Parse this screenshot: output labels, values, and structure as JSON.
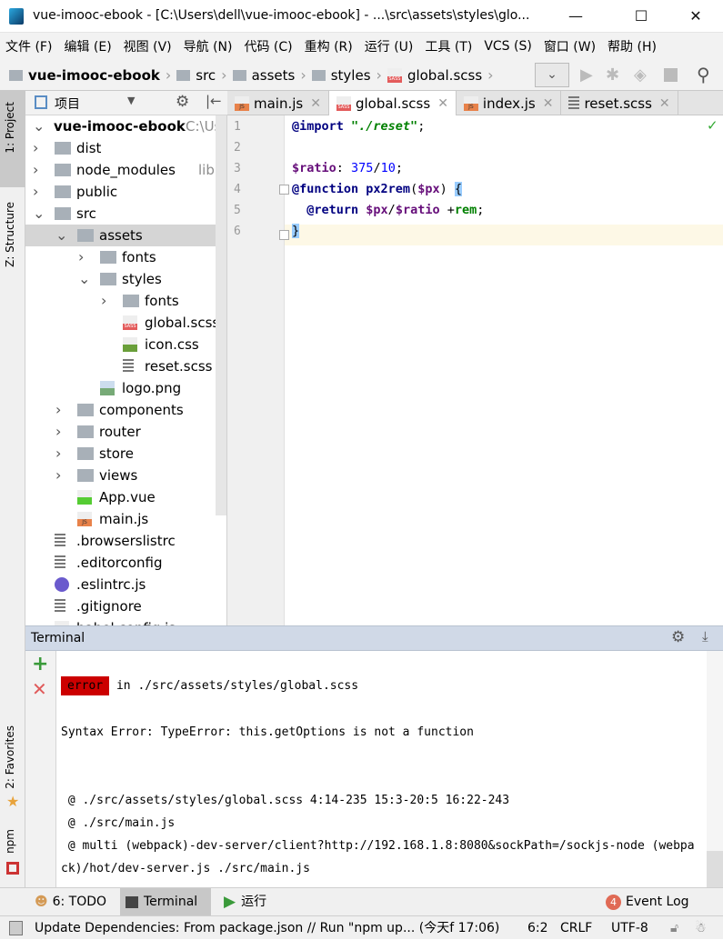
{
  "window": {
    "title": "vue-imooc-ebook - [C:\\Users\\dell\\vue-imooc-ebook] - ...\\src\\assets\\styles\\glo...",
    "minimize": "—",
    "maximize": "☐",
    "close": "✕"
  },
  "menu": [
    "文件 (F)",
    "编辑 (E)",
    "视图 (V)",
    "导航 (N)",
    "代码 (C)",
    "重构 (R)",
    "运行 (U)",
    "工具 (T)",
    "VCS (S)",
    "窗口 (W)",
    "帮助 (H)"
  ],
  "breadcrumb": [
    "vue-imooc-ebook",
    "src",
    "assets",
    "styles",
    "global.scss"
  ],
  "toolstrip": {
    "project": "1: Project",
    "structure": "Z: Structure",
    "favorites": "2: Favorites",
    "npm": "npm"
  },
  "project_panel": {
    "title": "项目"
  },
  "tree": [
    {
      "label": "vue-imooc-ebook",
      "hint": "C:\\Users",
      "depth": 0,
      "type": "root",
      "expanded": true
    },
    {
      "label": "dist",
      "depth": 0,
      "type": "folder",
      "expanded": false
    },
    {
      "label": "node_modules",
      "hint": "library",
      "depth": 0,
      "type": "folder",
      "expanded": false
    },
    {
      "label": "public",
      "depth": 0,
      "type": "folder",
      "expanded": false
    },
    {
      "label": "src",
      "depth": 0,
      "type": "folder",
      "expanded": true
    },
    {
      "label": "assets",
      "depth": 1,
      "type": "folder",
      "expanded": true,
      "selected": true
    },
    {
      "label": "fonts",
      "depth": 2,
      "type": "folder",
      "expanded": false
    },
    {
      "label": "styles",
      "depth": 2,
      "type": "folder",
      "expanded": true
    },
    {
      "label": "fonts",
      "depth": 3,
      "type": "folder",
      "expanded": false
    },
    {
      "label": "global.scss",
      "depth": 3,
      "type": "sass"
    },
    {
      "label": "icon.css",
      "depth": 3,
      "type": "css"
    },
    {
      "label": "reset.scss",
      "depth": 3,
      "type": "text"
    },
    {
      "label": "logo.png",
      "depth": 2,
      "type": "image"
    },
    {
      "label": "components",
      "depth": 1,
      "type": "folder",
      "expanded": false
    },
    {
      "label": "router",
      "depth": 1,
      "type": "folder",
      "expanded": false
    },
    {
      "label": "store",
      "depth": 1,
      "type": "folder",
      "expanded": false
    },
    {
      "label": "views",
      "depth": 1,
      "type": "folder",
      "expanded": false
    },
    {
      "label": "App.vue",
      "depth": 1,
      "type": "vue"
    },
    {
      "label": "main.js",
      "depth": 1,
      "type": "js"
    },
    {
      "label": ".browserslistrc",
      "depth": 0,
      "type": "text"
    },
    {
      "label": ".editorconfig",
      "depth": 0,
      "type": "text"
    },
    {
      "label": ".eslintrc.js",
      "depth": 0,
      "type": "eslint"
    },
    {
      "label": ".gitignore",
      "depth": 0,
      "type": "text"
    },
    {
      "label": "babel.config.js",
      "depth": 0,
      "type": "js"
    }
  ],
  "tabs": [
    {
      "label": "main.js",
      "icon": "js",
      "active": false
    },
    {
      "label": "global.scss",
      "icon": "sass",
      "active": true
    },
    {
      "label": "index.js",
      "icon": "js",
      "active": false
    },
    {
      "label": "reset.scss",
      "icon": "text",
      "active": false
    }
  ],
  "editor": {
    "line_numbers": [
      "1",
      "2",
      "3",
      "4",
      "5",
      "6"
    ],
    "lines": [
      [
        {
          "t": "@import ",
          "c": "kw"
        },
        {
          "t": "\"./reset\"",
          "c": "str"
        },
        {
          "t": ";",
          "c": ""
        }
      ],
      [],
      [
        {
          "t": "$ratio",
          "c": "var"
        },
        {
          "t": ": ",
          "c": ""
        },
        {
          "t": "375",
          "c": "num"
        },
        {
          "t": "/",
          "c": ""
        },
        {
          "t": "10",
          "c": "num"
        },
        {
          "t": ";",
          "c": ""
        }
      ],
      [
        {
          "t": "@function ",
          "c": "kw"
        },
        {
          "t": "px2rem",
          "c": "kw"
        },
        {
          "t": "(",
          "c": ""
        },
        {
          "t": "$px",
          "c": "var"
        },
        {
          "t": ") ",
          "c": ""
        },
        {
          "t": "{",
          "c": "br"
        }
      ],
      [
        {
          "t": "  @return ",
          "c": "kw"
        },
        {
          "t": "$px",
          "c": "var"
        },
        {
          "t": "/",
          "c": ""
        },
        {
          "t": "$ratio",
          "c": "var"
        },
        {
          "t": " +",
          "c": ""
        },
        {
          "t": "rem",
          "c": "grn"
        },
        {
          "t": ";",
          "c": ""
        }
      ],
      [
        {
          "t": "}",
          "c": "br"
        }
      ]
    ],
    "status_check": "✓"
  },
  "terminal": {
    "title": "Terminal",
    "error_badge": "error",
    "lines": [
      " in ./src/assets/styles/global.scss",
      "Syntax Error: TypeError: this.getOptions is not a function",
      " @ ./src/assets/styles/global.scss 4:14-235 15:3-20:5 16:22-243",
      " @ ./src/main.js",
      " @ multi (webpack)-dev-server/client?http://192.168.1.8:8080&sockPath=/sockjs-node (webpa",
      "ck)/hot/dev-server.js ./src/main.js"
    ]
  },
  "bottom_tabs": {
    "todo": "6: TODO",
    "terminal": "Terminal",
    "run": "运行",
    "event_log": "Event Log",
    "event_count": "4"
  },
  "status": {
    "message": "Update Dependencies: From package.json // Run \"npm up... (今天f 17:06)",
    "position": "6:2",
    "line_sep": "CRLF",
    "encoding": "UTF-8"
  },
  "colors": {
    "error": "#cc0000",
    "selection": "#d5d5d5",
    "terminal_header": "#d0d9e7",
    "current_line": "#fdf8e6"
  }
}
